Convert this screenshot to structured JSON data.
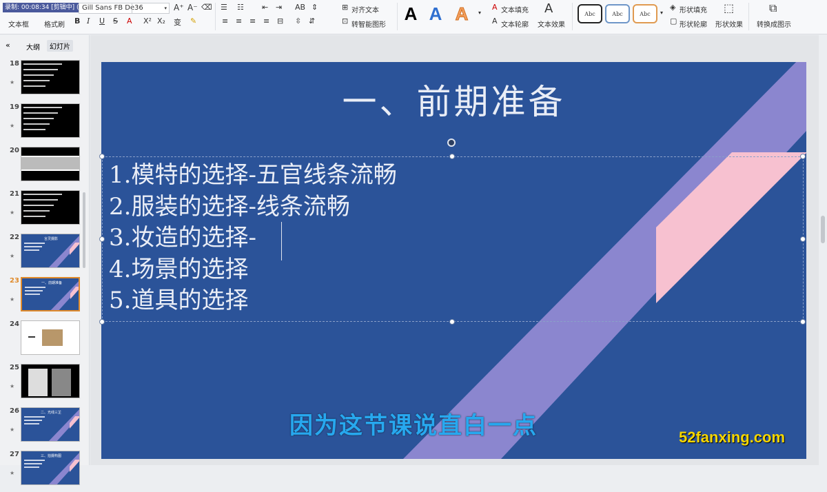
{
  "overlay": {
    "recording": "录制: 00:08:34 [剪辑中] (32x)"
  },
  "ribbon": {
    "font_name": "Gill Sans FB De",
    "font_size": "36",
    "textbox_label": "文本框",
    "format_painter_label": "格式刷",
    "align_text_label": "对齐文本",
    "smartart_label": "转智能图形",
    "text_fill_label": "文本填充",
    "text_outline_label": "文本轮廓",
    "text_effect_label": "文本效果",
    "shape_fill_label": "形状填充",
    "shape_outline_label": "形状轮廓",
    "shape_effect_label": "形状效果",
    "convert_label": "转换成图示",
    "style_glyph": "A",
    "abc_glyph": "Abc",
    "font_size_up": "A⁺",
    "font_size_down": "A⁻",
    "clear_format": "⌫"
  },
  "left_panel": {
    "tab_outline": "大纲",
    "tab_slides": "幻灯片",
    "collapse_glyph": "«",
    "slides": [
      {
        "num": "18",
        "theme": "black",
        "has_star": true
      },
      {
        "num": "19",
        "theme": "black",
        "has_star": true
      },
      {
        "num": "20",
        "theme": "gray",
        "has_star": false
      },
      {
        "num": "21",
        "theme": "black",
        "has_star": true
      },
      {
        "num": "22",
        "theme": "blue",
        "has_star": true,
        "mini_title": "言灵摄影"
      },
      {
        "num": "23",
        "theme": "blue-active",
        "has_star": true,
        "mini_title": "一、前期准备"
      },
      {
        "num": "24",
        "theme": "white",
        "has_star": false
      },
      {
        "num": "25",
        "theme": "photos",
        "has_star": true
      },
      {
        "num": "26",
        "theme": "blue",
        "has_star": true,
        "mini_title": "二、光线三芷"
      },
      {
        "num": "27",
        "theme": "blue",
        "has_star": true,
        "mini_title": "三、拍摄构图"
      }
    ]
  },
  "slide": {
    "title": "一、前期准备",
    "items": [
      "1.模特的选择-五官线条流畅",
      "2.服装的选择-线条流畅",
      "3.妆造的选择-",
      "4.场景的选择",
      "5.道具的选择"
    ],
    "background_color": "#2b5399",
    "stripe_color": "#8b86cf",
    "pink_color": "#f7c1d0"
  },
  "subtitle": "因为这节课说直白一点",
  "watermark": "52fanxing.com"
}
